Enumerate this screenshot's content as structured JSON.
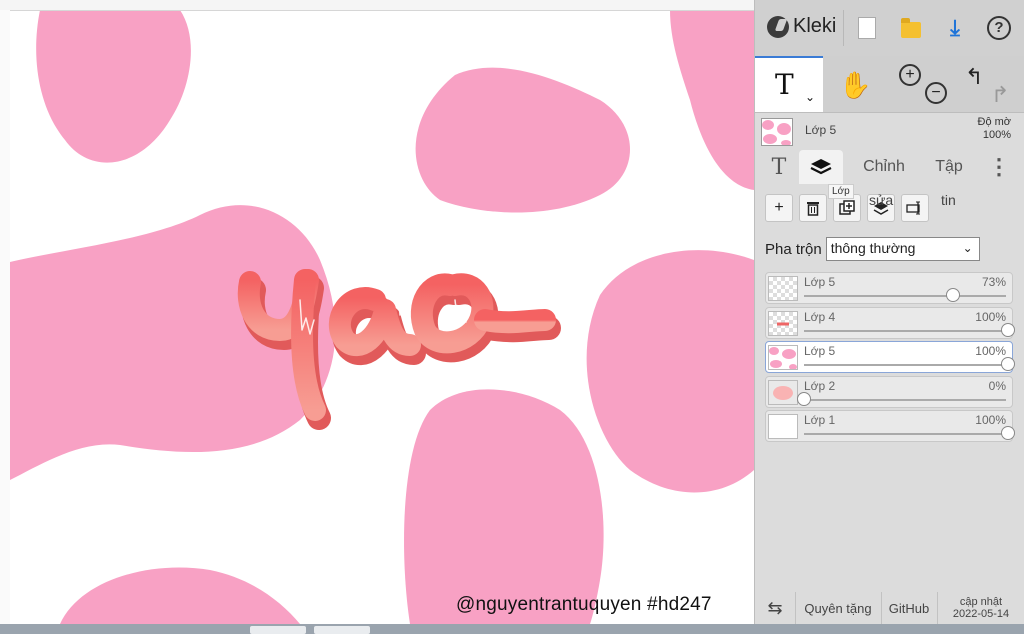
{
  "canvas": {
    "watermark": "@nguyentrantuquyen  #hd247",
    "artwork_text": "yao.",
    "colors": {
      "background": "#ffffff",
      "spots": "#f8a1c4",
      "lettering": "#f26e6e"
    }
  },
  "toolbar": {
    "app_name": "Kleki",
    "new_icon": "new-document-icon",
    "open_icon": "folder-icon",
    "download_icon": "download-icon",
    "help_label": "?"
  },
  "tools": {
    "text_tool_label": "T",
    "hand_tool_icon": "hand-icon",
    "zoom_in_label": "+",
    "zoom_out_label": "−",
    "undo_icon": "undo-icon",
    "redo_icon": "redo-icon"
  },
  "current_layer": {
    "name": "Lớp 5",
    "opacity_label": "Độ mờ",
    "opacity_value": "100%"
  },
  "tabs": {
    "text_tab": "T",
    "layers_tab_icon": "layers-icon",
    "adjust_tab": "Chỉnh",
    "file_tab": "Tập",
    "more": "⋮"
  },
  "tooltip": {
    "text": "Lớp"
  },
  "layer_actions": {
    "add": "+",
    "merge_text": "sửa",
    "info_text": "tin"
  },
  "blend": {
    "label": "Pha trộn",
    "value": "thông thường"
  },
  "layers": [
    {
      "name": "Lớp 5",
      "opacity": "73%",
      "level": 0.73,
      "active": false,
      "thumb": "checker"
    },
    {
      "name": "Lớp 4",
      "opacity": "100%",
      "level": 1.0,
      "active": false,
      "thumb": "checker-text"
    },
    {
      "name": "Lớp 5",
      "opacity": "100%",
      "level": 1.0,
      "active": true,
      "thumb": "spots"
    },
    {
      "name": "Lớp 2",
      "opacity": "0%",
      "level": 0.0,
      "active": false,
      "thumb": "blob"
    },
    {
      "name": "Lớp 1",
      "opacity": "100%",
      "level": 1.0,
      "active": false,
      "thumb": "white"
    }
  ],
  "footer": {
    "swap_icon": "swap-icon",
    "donate": "Quyên tặng",
    "github": "GitHub",
    "update_line1": "cập nhật",
    "update_line2": "2022-05-14"
  }
}
